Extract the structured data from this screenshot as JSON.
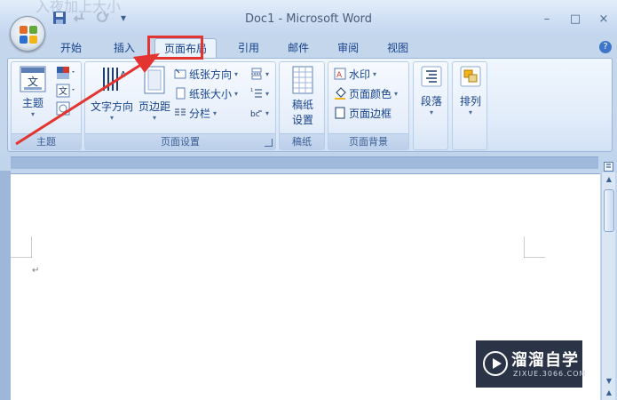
{
  "window": {
    "title": "Doc1 - Microsoft Word",
    "bg_text": "入夜加上大小"
  },
  "window_controls": {
    "minimize": "–",
    "maximize": "□",
    "close": "×"
  },
  "qat": {
    "dropdown": "▾"
  },
  "tabs": [
    {
      "label": "开始"
    },
    {
      "label": "插入"
    },
    {
      "label": "页面布局"
    },
    {
      "label": "引用"
    },
    {
      "label": "邮件"
    },
    {
      "label": "审阅"
    },
    {
      "label": "视图"
    }
  ],
  "active_tab": "页面布局",
  "help": "?",
  "ribbon": {
    "theme_group": {
      "label": "主题",
      "theme_button": "主题"
    },
    "page_setup_group": {
      "label": "页面设置",
      "text_direction": "文字方向",
      "margins": "页边距",
      "orientation": "纸张方向",
      "size": "纸张大小",
      "columns": "分栏"
    },
    "manuscript_group": {
      "label": "稿纸",
      "manuscript_setup_line1": "稿纸",
      "manuscript_setup_line2": "设置"
    },
    "background_group": {
      "label": "页面背景",
      "watermark": "水印",
      "page_color": "页面颜色",
      "page_borders": "页面边框"
    },
    "paragraph": "段落",
    "arrange": "排列"
  },
  "document": {
    "paragraph_mark": "↵"
  },
  "watermark_badge": {
    "title": "溜溜自学",
    "url": "ZIXUE.3066.COM"
  },
  "colors": {
    "accent_red": "#e3342f",
    "ribbon_text": "#15428b"
  }
}
